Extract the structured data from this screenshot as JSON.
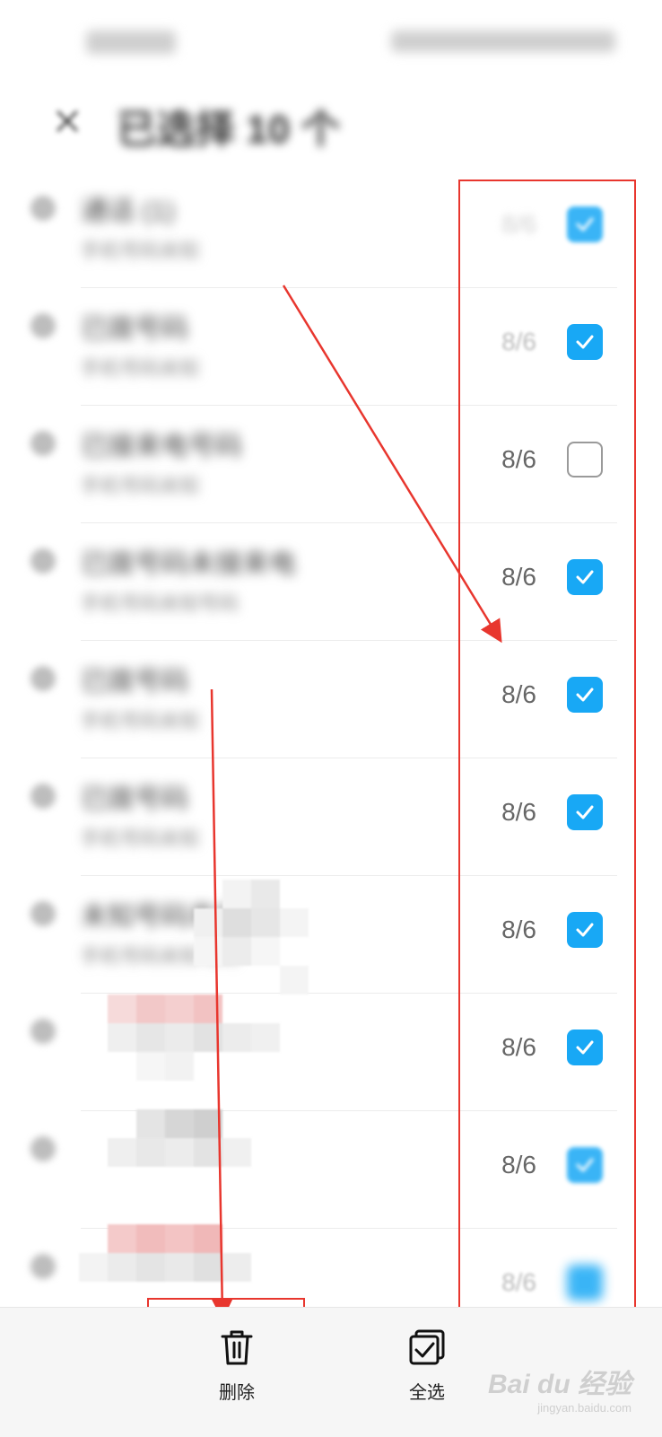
{
  "header": {
    "title": "已选择 10 个"
  },
  "list": {
    "items": [
      {
        "title": "通话 (1)",
        "subtitle": "手机号码未知",
        "date": "8/6",
        "checked": true
      },
      {
        "title": "已拨号码",
        "subtitle": "手机号码未知",
        "date": "8/6",
        "checked": true
      },
      {
        "title": "已接来电号码",
        "subtitle": "手机号码未知",
        "date": "8/6",
        "checked": false
      },
      {
        "title": "已拨号码未接来电",
        "subtitle": "手机号码未知号码",
        "date": "8/6",
        "checked": true
      },
      {
        "title": "已拨号码",
        "subtitle": "手机号码未知",
        "date": "8/6",
        "checked": true
      },
      {
        "title": "已拨号码",
        "subtitle": "手机号码未知",
        "date": "8/6",
        "checked": true
      },
      {
        "title": "未知号码来电",
        "subtitle": "手机号码未知号码",
        "date": "8/6",
        "checked": true
      },
      {
        "title": "",
        "subtitle": "",
        "date": "8/6",
        "checked": true
      },
      {
        "title": "",
        "subtitle": "",
        "date": "8/6",
        "checked": true
      },
      {
        "title": "",
        "subtitle": "",
        "date": "8/6",
        "checked": true
      }
    ]
  },
  "bottom_bar": {
    "delete_label": "删除",
    "select_all_label": "全选"
  },
  "watermark": {
    "text": "Bai du 经验",
    "url": "jingyan.baidu.com"
  },
  "colors": {
    "accent": "#18a8f5",
    "annotation": "#e8362e"
  },
  "icons": {
    "delete": "trash-icon",
    "select_all": "select-all-icon",
    "check": "checkmark-icon"
  }
}
